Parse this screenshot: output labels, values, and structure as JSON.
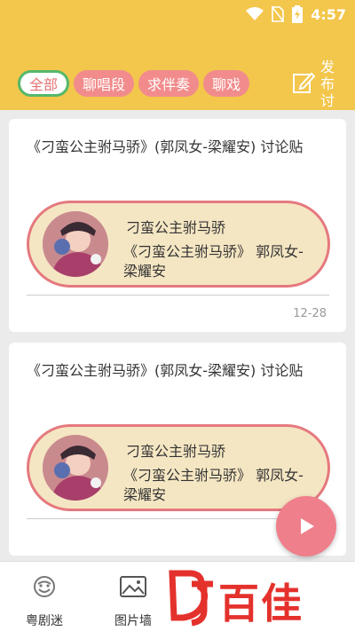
{
  "status_bar": {
    "time": "4:57",
    "icons": [
      "wifi-icon",
      "no-sim-icon",
      "battery-charging-icon"
    ]
  },
  "filter_tabs": [
    {
      "label": "全部",
      "active": true
    },
    {
      "label": "聊唱段",
      "active": false
    },
    {
      "label": "求伴奏",
      "active": false
    },
    {
      "label": "聊戏",
      "active": false
    }
  ],
  "post_button": {
    "label": "发布讨",
    "icon": "edit-icon"
  },
  "posts": [
    {
      "title": "《刁蛮公主驸马骄》(郭凤女-梁耀安) 讨论贴",
      "song_name": "刁蛮公主驸马骄",
      "song_artist": "《刁蛮公主驸马骄》 郭凤女-梁耀安",
      "date": "12-28"
    },
    {
      "title": "《刁蛮公主驸马骄》(郭凤女-梁耀安) 讨论贴",
      "song_name": "刁蛮公主驸马骄",
      "song_artist": "《刁蛮公主驸马骄》 郭凤女-梁耀安",
      "date": ""
    }
  ],
  "play_button": {
    "icon": "play-icon"
  },
  "bottom_nav": [
    {
      "label": "粤剧迷",
      "icon": "opera-mask-icon"
    },
    {
      "label": "图片墙",
      "icon": "image-icon"
    },
    {
      "label": "",
      "icon": ""
    },
    {
      "label": "",
      "icon": ""
    }
  ],
  "watermark": {
    "text": "百佳",
    "logo": "BJ"
  },
  "colors": {
    "header": "#f3c64c",
    "tab_pink": "#f28c8c",
    "active_border": "#55b86a",
    "pill_bg": "#f5e6c3",
    "pill_border": "#e5797e",
    "fab": "#ef7f8a",
    "watermark_red": "#e4312c"
  }
}
